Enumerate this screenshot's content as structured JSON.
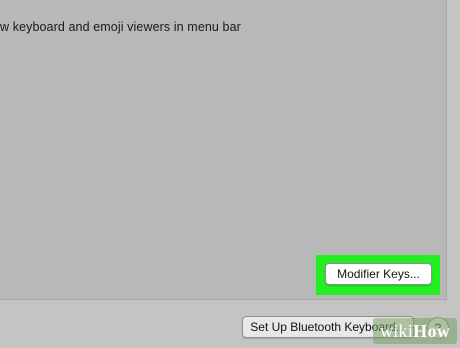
{
  "options": {
    "show_viewers_label": "w keyboard and emoji viewers in menu bar"
  },
  "buttons": {
    "modifier_keys": "Modifier Keys...",
    "bluetooth_keyboard": "Set Up Bluetooth Keyboard...",
    "help": "?"
  },
  "watermark": {
    "part1": "wiki",
    "part2": "How"
  },
  "colors": {
    "highlight": "#22ee22",
    "panel": "#b8b8b8"
  }
}
